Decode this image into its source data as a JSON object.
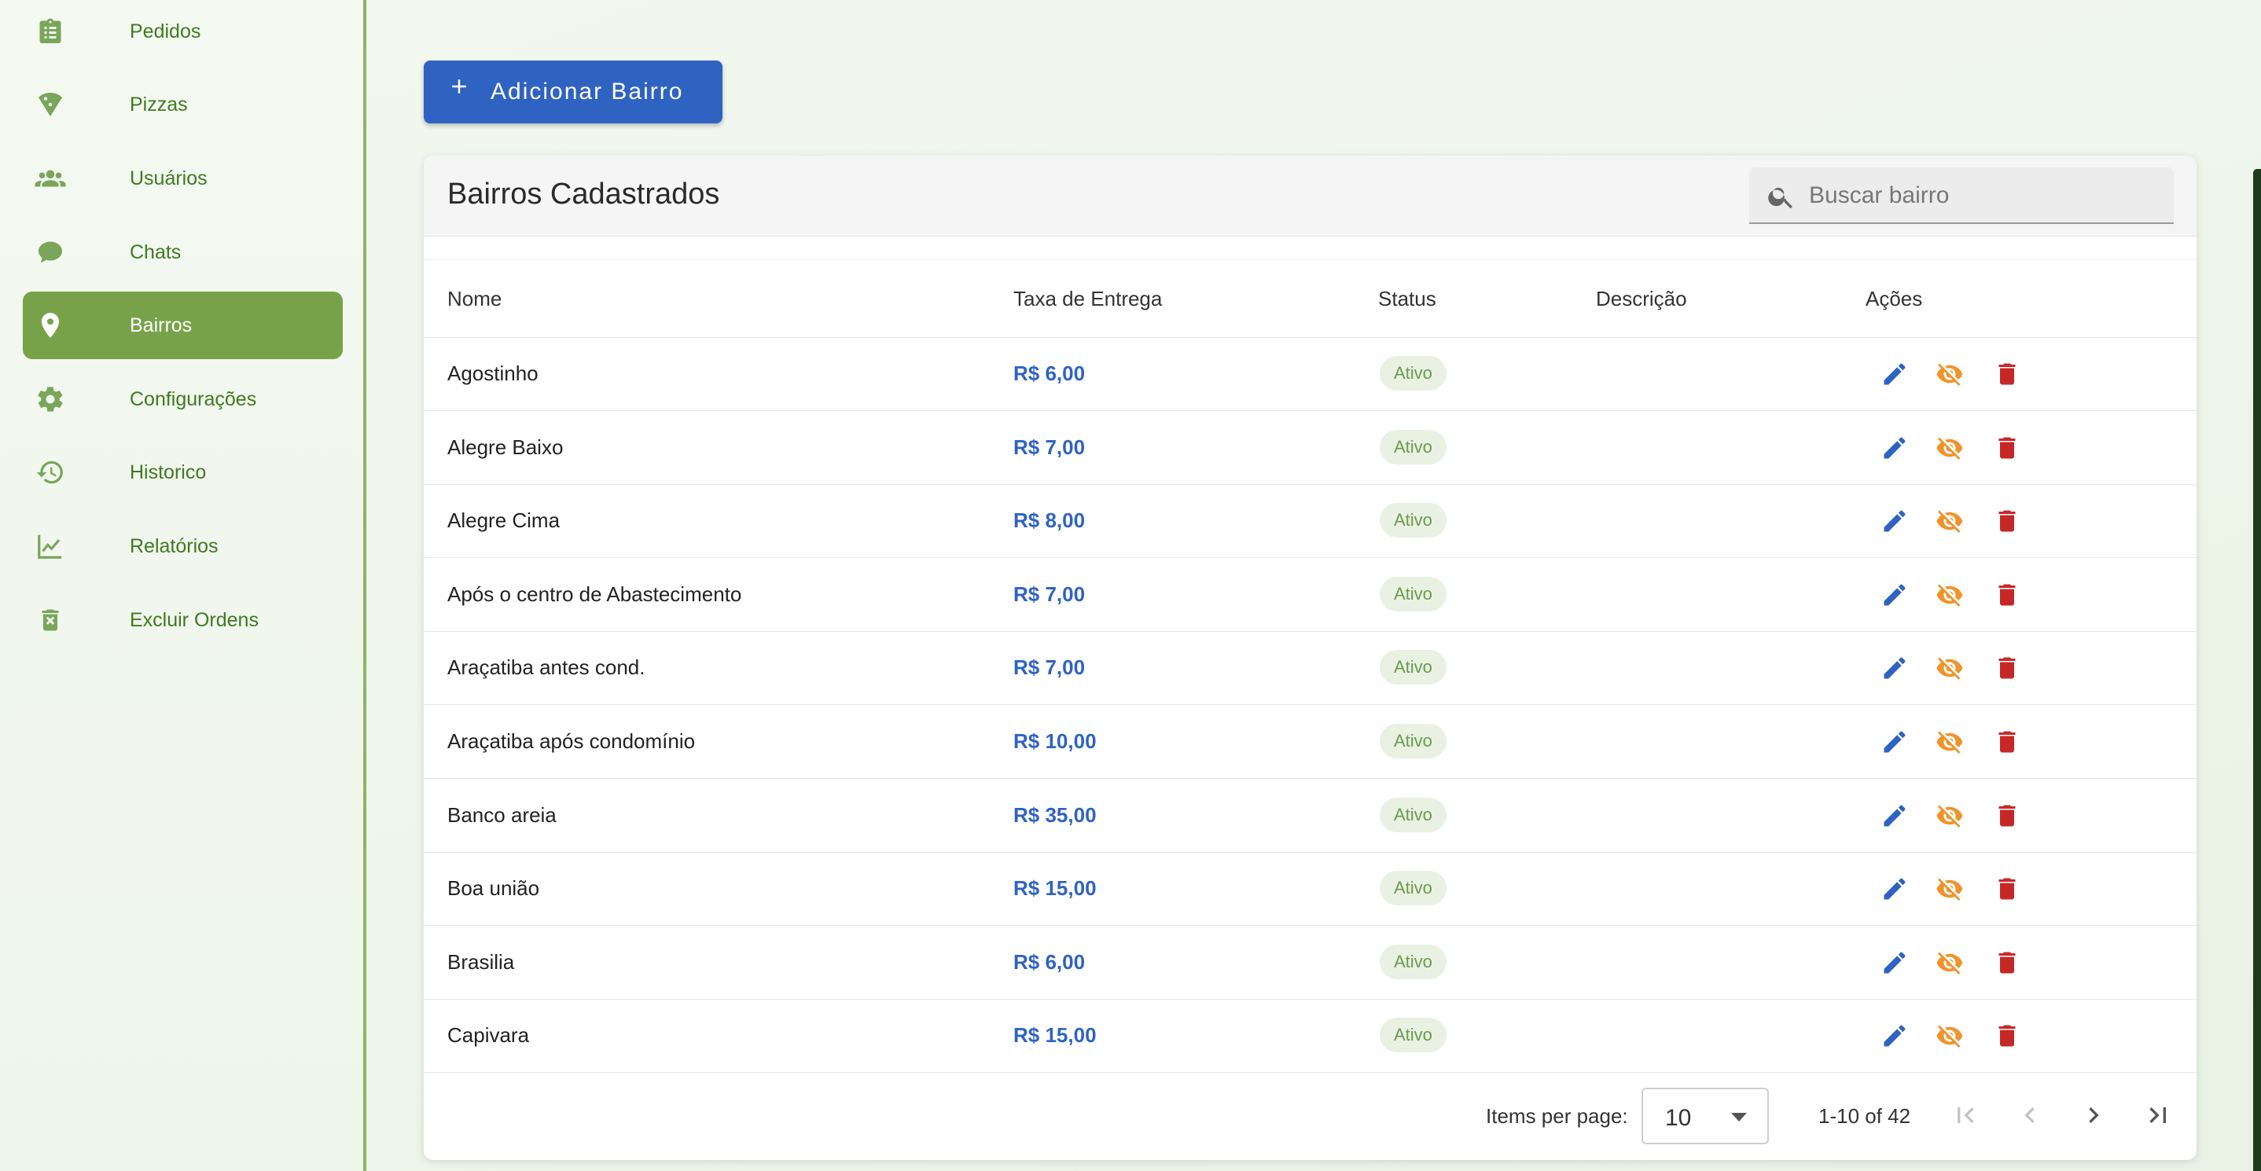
{
  "sidebar": {
    "items": [
      {
        "label": "Pedidos",
        "icon": "clipboard-list-icon"
      },
      {
        "label": "Pizzas",
        "icon": "pizza-icon"
      },
      {
        "label": "Usuários",
        "icon": "users-icon"
      },
      {
        "label": "Chats",
        "icon": "chat-bubble-icon"
      },
      {
        "label": "Bairros",
        "icon": "map-pin-icon",
        "active": true
      },
      {
        "label": "Configurações",
        "icon": "gear-icon"
      },
      {
        "label": "Historico",
        "icon": "history-icon"
      },
      {
        "label": "Relatórios",
        "icon": "line-chart-icon"
      },
      {
        "label": "Excluir Ordens",
        "icon": "trash-icon"
      }
    ]
  },
  "toolbar": {
    "add_label": "Adicionar Bairro"
  },
  "card": {
    "title": "Bairros Cadastrados",
    "search_placeholder": "Buscar bairro"
  },
  "table": {
    "headers": [
      "Nome",
      "Taxa de Entrega",
      "Status",
      "Descrição",
      "Ações"
    ],
    "rows": [
      {
        "name": "Agostinho",
        "fee": "R$ 6,00",
        "status": "Ativo",
        "description": ""
      },
      {
        "name": "Alegre Baixo",
        "fee": "R$ 7,00",
        "status": "Ativo",
        "description": ""
      },
      {
        "name": "Alegre Cima",
        "fee": "R$ 8,00",
        "status": "Ativo",
        "description": ""
      },
      {
        "name": "Após o centro de Abastecimento",
        "fee": "R$ 7,00",
        "status": "Ativo",
        "description": ""
      },
      {
        "name": "Araçatiba antes cond.",
        "fee": "R$ 7,00",
        "status": "Ativo",
        "description": ""
      },
      {
        "name": "Araçatiba após condomínio",
        "fee": "R$ 10,00",
        "status": "Ativo",
        "description": ""
      },
      {
        "name": "Banco areia",
        "fee": "R$ 35,00",
        "status": "Ativo",
        "description": ""
      },
      {
        "name": "Boa união",
        "fee": "R$ 15,00",
        "status": "Ativo",
        "description": ""
      },
      {
        "name": "Brasilia",
        "fee": "R$ 6,00",
        "status": "Ativo",
        "description": ""
      },
      {
        "name": "Capivara",
        "fee": "R$ 15,00",
        "status": "Ativo",
        "description": ""
      }
    ]
  },
  "paginator": {
    "items_per_page_label": "Items per page:",
    "items_per_page": "10",
    "range": "1-10 of 42"
  },
  "colors": {
    "primary": "#2f63c2",
    "sidebar_active": "#78a24a",
    "sidebar_text": "#3f7a22",
    "edit": "#2f63c2",
    "hide": "#f0932b",
    "delete": "#c62828",
    "status_badge_bg": "#e9f1e3",
    "status_badge_text": "#6a9b4b"
  }
}
